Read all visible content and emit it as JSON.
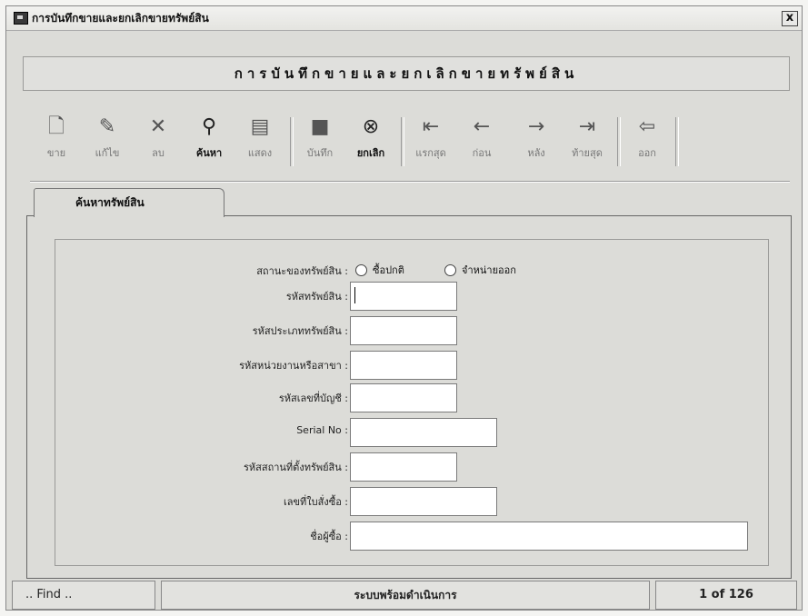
{
  "window": {
    "title": "การบันทึกขายและยกเลิกขายทรัพย์สิน",
    "close_glyph": "x"
  },
  "header": {
    "title": "การบันทึกขายและยกเลิกขายทรัพย์สิน"
  },
  "toolbar": {
    "buttons": [
      {
        "label": "ขาย",
        "icon": "new-document-icon",
        "glyph": "🗋"
      },
      {
        "label": "แก้ไข",
        "icon": "edit-icon",
        "glyph": "✎"
      },
      {
        "label": "ลบ",
        "icon": "delete-x-icon",
        "glyph": "✕"
      },
      {
        "label": "ค้นหา",
        "icon": "binoculars-icon",
        "glyph": "⚲"
      },
      {
        "label": "แสดง",
        "icon": "list-view-icon",
        "glyph": "▤"
      },
      {
        "label": "บันทึก",
        "icon": "save-icon",
        "glyph": "■"
      },
      {
        "label": "ยกเลิก",
        "icon": "cancel-icon",
        "glyph": "⊗"
      },
      {
        "label": "แรกสุด",
        "icon": "first-record-icon",
        "glyph": "⇤"
      },
      {
        "label": "ก่อน",
        "icon": "previous-record-icon",
        "glyph": "←"
      },
      {
        "label": "หลัง",
        "icon": "next-record-icon",
        "glyph": "→"
      },
      {
        "label": "ท้ายสุด",
        "icon": "last-record-icon",
        "glyph": "⇥"
      },
      {
        "label": "ออก",
        "icon": "exit-door-icon",
        "glyph": "⇦"
      }
    ]
  },
  "tab": {
    "label": "ค้นหาทรัพย์สิน"
  },
  "form": {
    "status_label": "สถานะของทรัพย์สิน :",
    "status_options": [
      "ซื้อปกติ",
      "จำหน่ายออก"
    ],
    "fields": [
      {
        "label": "รหัสทรัพย์สิน :",
        "value": ""
      },
      {
        "label": "รหัสประเภททรัพย์สิน :",
        "value": ""
      },
      {
        "label": "รหัสหน่วยงานหรือสาขา :",
        "value": ""
      },
      {
        "label": "รหัสเลขที่บัญชี :",
        "value": ""
      },
      {
        "label": "Serial No :",
        "value": ""
      },
      {
        "label": "รหัสสถานที่ตั้งทรัพย์สิน :",
        "value": ""
      },
      {
        "label": "เลขที่ใบสั่งซื้อ :",
        "value": ""
      },
      {
        "label": "ชื่อผู้ซื้อ :",
        "value": ""
      }
    ]
  },
  "statusbar": {
    "find": ".. Find ..",
    "message": "ระบบพร้อมดำเนินการ",
    "record": "1 of 126"
  }
}
